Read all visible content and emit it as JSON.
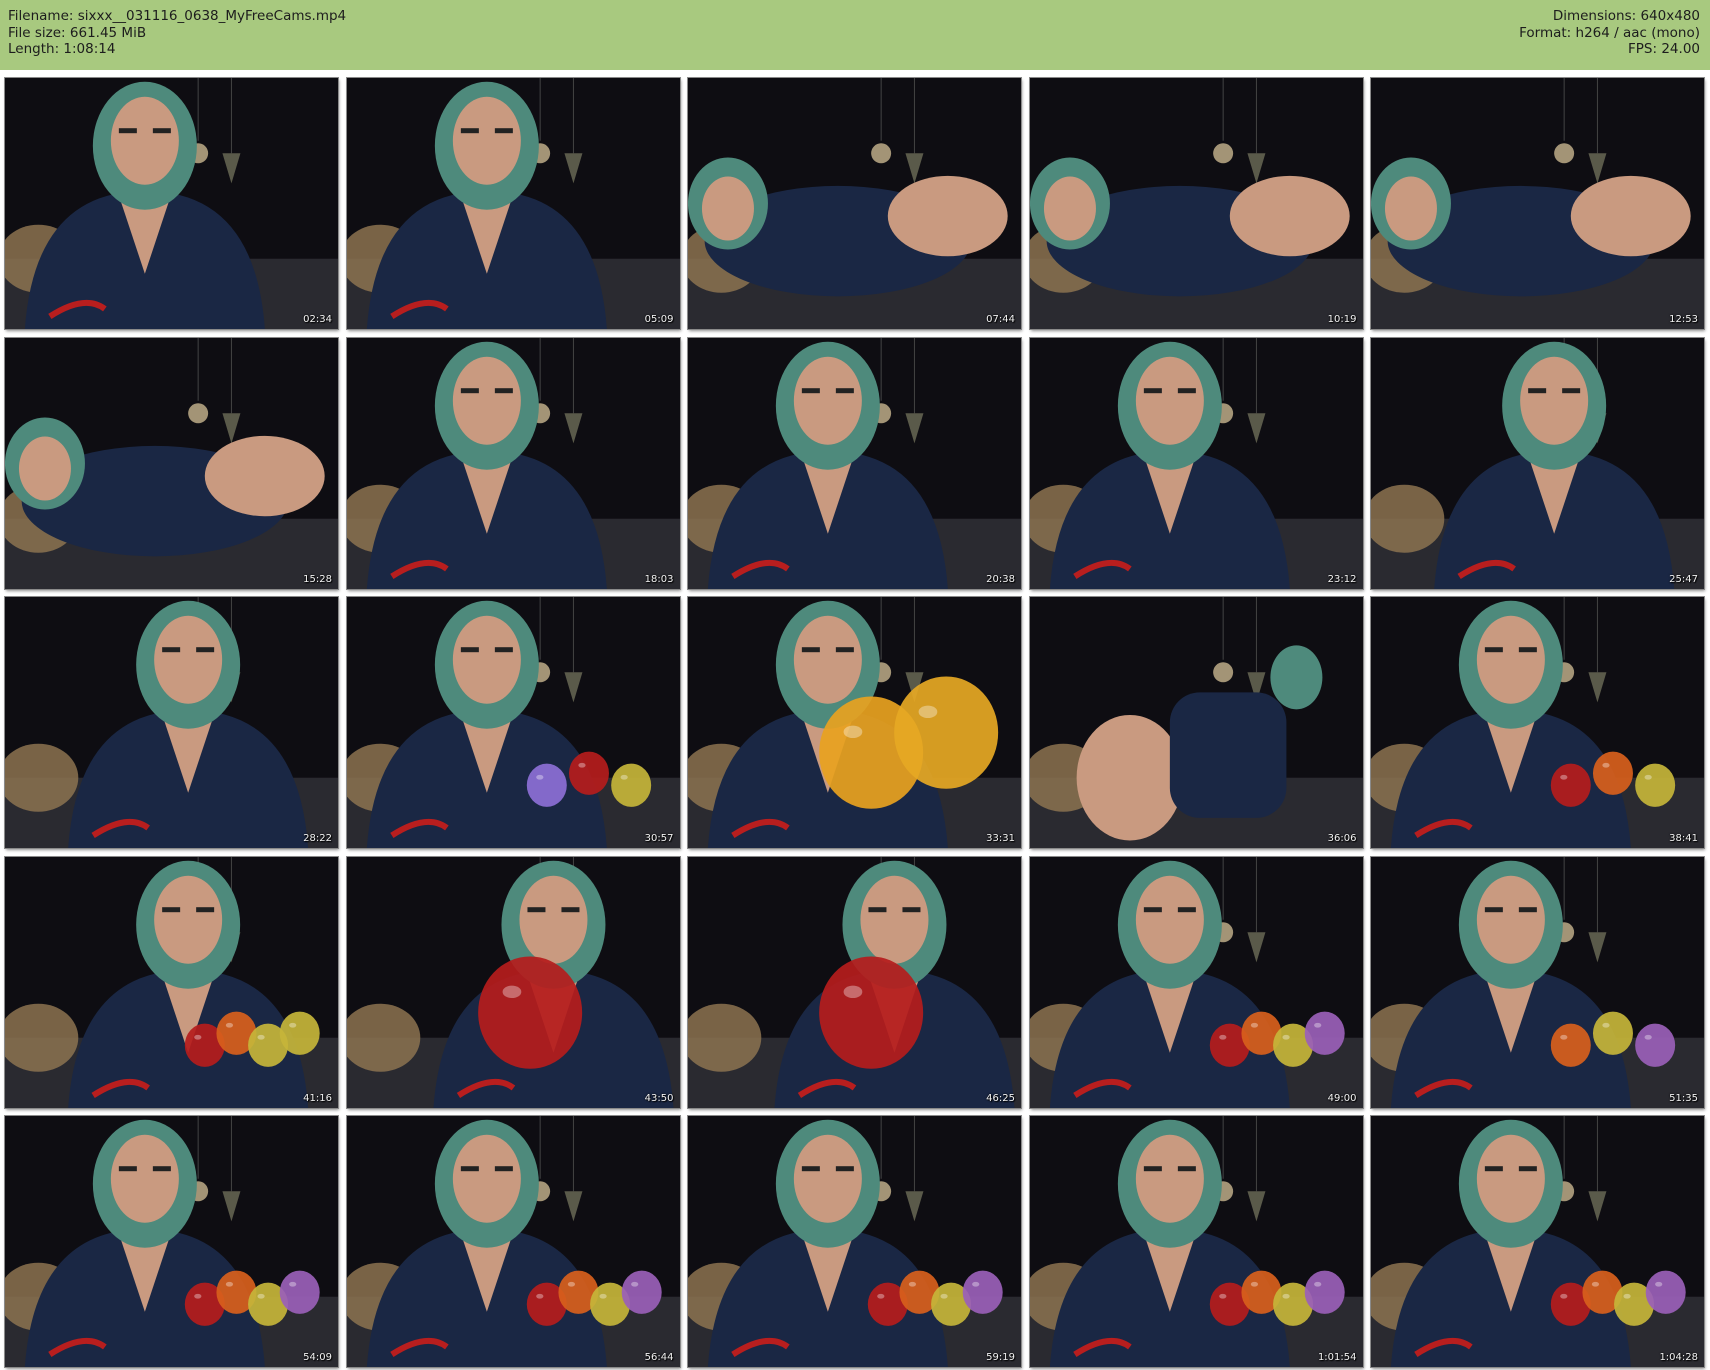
{
  "header": {
    "filename_label": "Filename:",
    "filename": "sixxx__031116_0638_MyFreeCams.mp4",
    "filesize_label": "File size:",
    "filesize": "661.45 MiB",
    "length_label": "Length:",
    "length": "1:08:14",
    "dimensions_label": "Dimensions:",
    "dimensions": "640x480",
    "format_label": "Format:",
    "format": "h264 / aac (mono)",
    "fps_label": "FPS:",
    "fps": "24.00"
  },
  "colors": {
    "header_bg": "#a8c97f",
    "jersey": "#1a2744",
    "hair": "#4e8a7c",
    "skin": "#c99a80"
  },
  "thumbnails": [
    {
      "timestamp": "02:34",
      "scene": "seated-front",
      "balloons": []
    },
    {
      "timestamp": "05:09",
      "scene": "seated-front",
      "balloons": []
    },
    {
      "timestamp": "07:44",
      "scene": "lying-away",
      "balloons": []
    },
    {
      "timestamp": "10:19",
      "scene": "lying-side",
      "balloons": []
    },
    {
      "timestamp": "12:53",
      "scene": "lying-side",
      "balloons": []
    },
    {
      "timestamp": "15:28",
      "scene": "lying-side",
      "balloons": []
    },
    {
      "timestamp": "18:03",
      "scene": "seated-front",
      "balloons": []
    },
    {
      "timestamp": "20:38",
      "scene": "seated-front",
      "balloons": []
    },
    {
      "timestamp": "23:12",
      "scene": "seated-front",
      "balloons": []
    },
    {
      "timestamp": "25:47",
      "scene": "leaning",
      "balloons": []
    },
    {
      "timestamp": "28:22",
      "scene": "leaning",
      "balloons": []
    },
    {
      "timestamp": "30:57",
      "scene": "seated-front",
      "balloons": [
        "#8c6fd6",
        "#b51c1c",
        "#c5b53a"
      ]
    },
    {
      "timestamp": "33:31",
      "scene": "seated-front",
      "balloons": [
        "#e8a220",
        "#e6a824"
      ]
    },
    {
      "timestamp": "36:06",
      "scene": "kneeling",
      "balloons": []
    },
    {
      "timestamp": "38:41",
      "scene": "seated-front",
      "balloons": [
        "#b51c1c",
        "#d8601c",
        "#c5b53a"
      ]
    },
    {
      "timestamp": "41:16",
      "scene": "leaning",
      "balloons": [
        "#b51c1c",
        "#d8601c",
        "#c5b53a",
        "#c5b53a"
      ]
    },
    {
      "timestamp": "43:50",
      "scene": "seated-side",
      "balloons": [
        "#b51c1c"
      ]
    },
    {
      "timestamp": "46:25",
      "scene": "seated-side",
      "balloons": [
        "#b51c1c"
      ]
    },
    {
      "timestamp": "49:00",
      "scene": "seated-front",
      "balloons": [
        "#b51c1c",
        "#d8601c",
        "#c5b53a",
        "#9a5fb8"
      ]
    },
    {
      "timestamp": "51:35",
      "scene": "seated-front",
      "balloons": [
        "#d8601c",
        "#c5b53a",
        "#9a5fb8"
      ]
    },
    {
      "timestamp": "54:09",
      "scene": "seated-front",
      "balloons": [
        "#b51c1c",
        "#d8601c",
        "#c5b53a",
        "#9a5fb8"
      ]
    },
    {
      "timestamp": "56:44",
      "scene": "seated-front",
      "balloons": [
        "#b51c1c",
        "#d8601c",
        "#c5b53a",
        "#9a5fb8"
      ]
    },
    {
      "timestamp": "59:19",
      "scene": "seated-front",
      "balloons": [
        "#b51c1c",
        "#d8601c",
        "#c5b53a",
        "#9a5fb8"
      ]
    },
    {
      "timestamp": "1:01:54",
      "scene": "seated-front",
      "balloons": [
        "#b51c1c",
        "#d8601c",
        "#c5b53a",
        "#9a5fb8"
      ]
    },
    {
      "timestamp": "1:04:28",
      "scene": "seated-front",
      "balloons": [
        "#b51c1c",
        "#d8601c",
        "#c5b53a",
        "#9a5fb8"
      ]
    }
  ]
}
